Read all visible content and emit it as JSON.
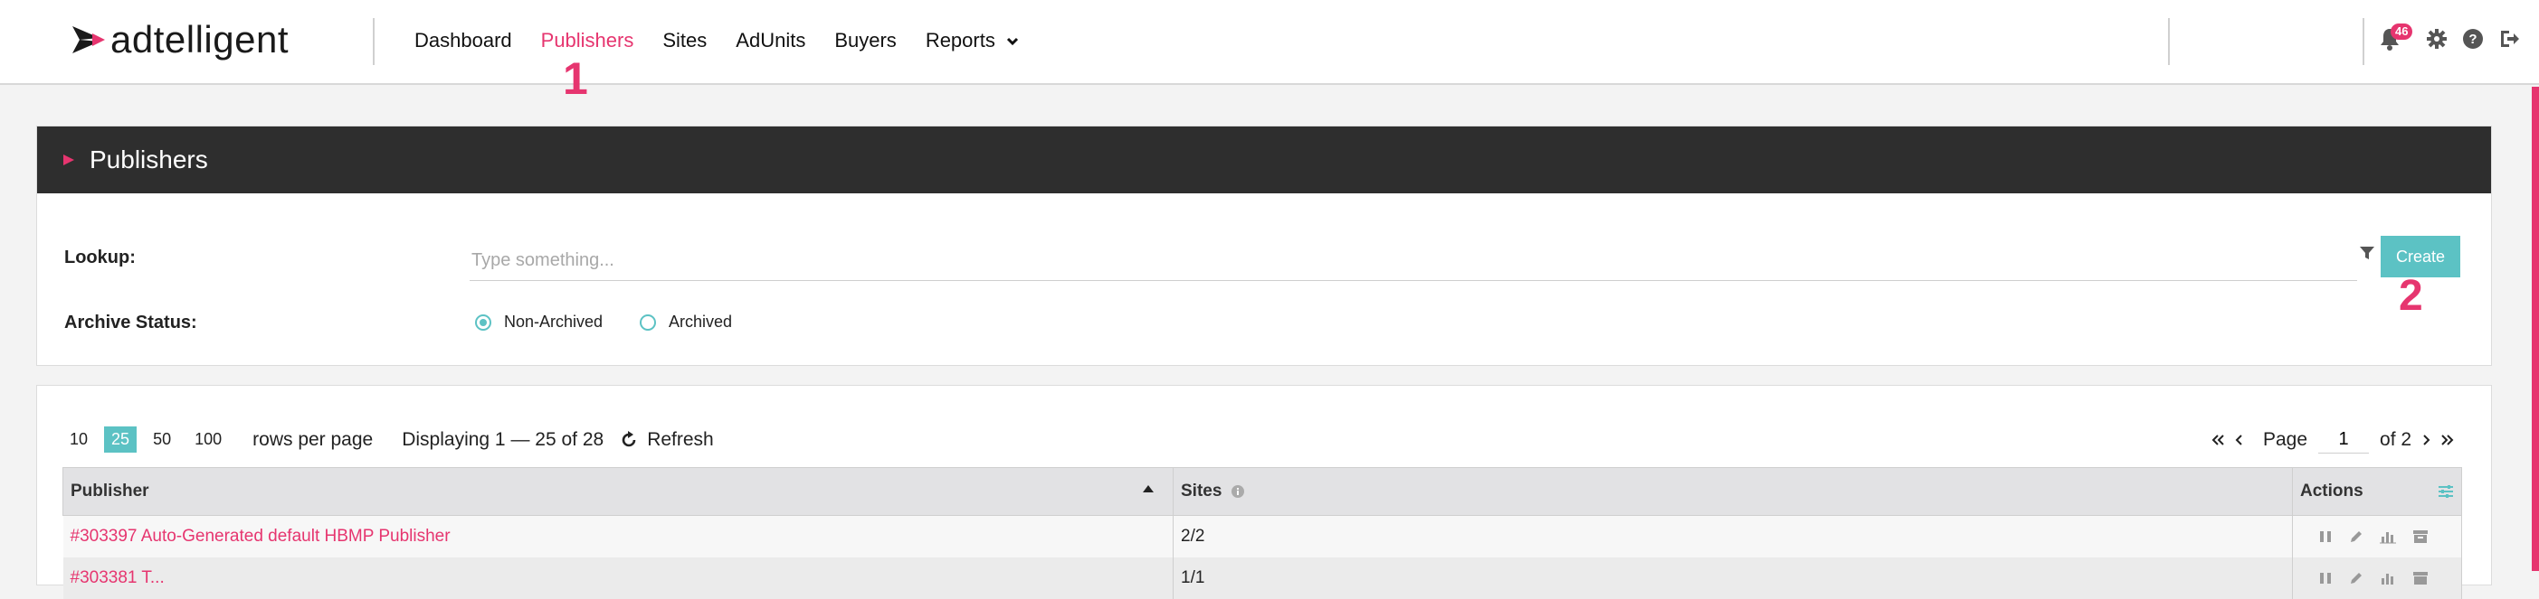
{
  "app": {
    "logo_text": "adtelligent"
  },
  "nav": {
    "items": [
      {
        "label": "Dashboard",
        "active": false
      },
      {
        "label": "Publishers",
        "active": true
      },
      {
        "label": "Sites",
        "active": false
      },
      {
        "label": "AdUnits",
        "active": false
      },
      {
        "label": "Buyers",
        "active": false
      },
      {
        "label": "Reports",
        "active": false,
        "has_caret": true
      }
    ]
  },
  "annotations": {
    "mark_1": "1",
    "mark_2": "2"
  },
  "header_icons": {
    "notifications_count": "46",
    "icons": [
      "bell-icon",
      "gear-icon",
      "help-icon",
      "logout-icon"
    ]
  },
  "panel": {
    "title": "Publishers",
    "lookup_label": "Lookup:",
    "lookup_placeholder": "Type something...",
    "lookup_value": "",
    "create_label": "Create",
    "archive_label": "Archive Status:",
    "archive_options": [
      {
        "label": "Non-Archived",
        "selected": true
      },
      {
        "label": "Archived",
        "selected": false
      }
    ]
  },
  "grid": {
    "page_sizes": [
      "10",
      "25",
      "50",
      "100"
    ],
    "selected_page_size": "25",
    "rows_per_page_label": "rows per page",
    "displaying": "Displaying 1 — 25 of 28",
    "refresh_label": "Refresh",
    "page_label": "Page",
    "page_value": "1",
    "of_label": "of 2",
    "columns": [
      {
        "label": "Publisher",
        "sorted": "asc"
      },
      {
        "label": "Sites",
        "info": true
      },
      {
        "label": "Actions"
      }
    ],
    "rows": [
      {
        "publisher": "#303397 Auto-Generated default HBMP Publisher",
        "sites": "2/2"
      },
      {
        "publisher": "#303381 T...",
        "sites": "1/1"
      }
    ]
  },
  "colors": {
    "accent": "#e6356f",
    "teal": "#5cc2c4",
    "panel_header": "#2e2e2e"
  }
}
